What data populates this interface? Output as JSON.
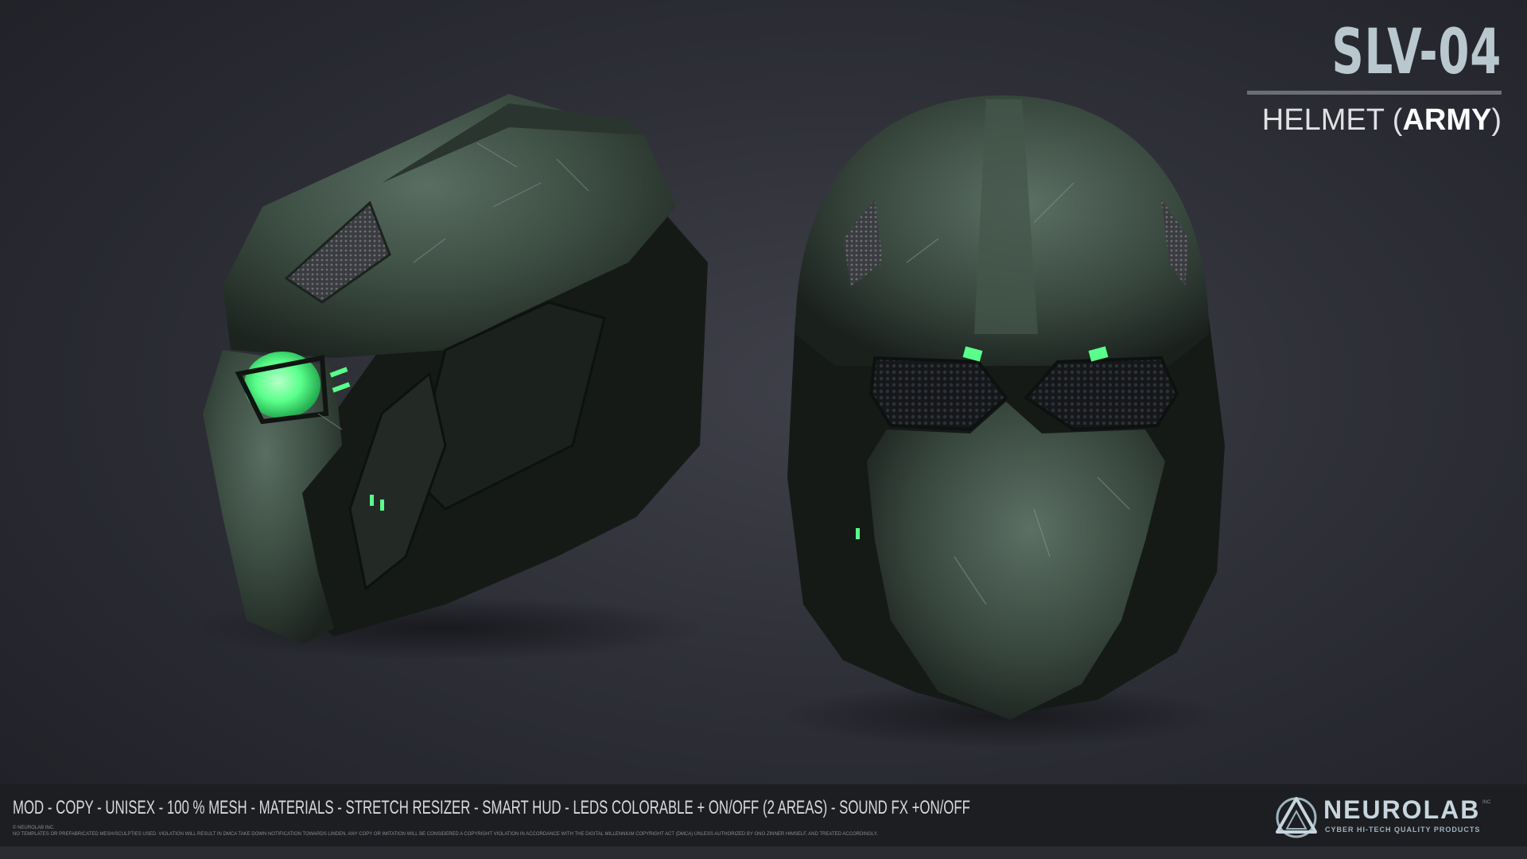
{
  "header": {
    "product_code": "SLV-04",
    "subtitle_prefix": "HELMET (",
    "subtitle_emphasis": "ARMY",
    "subtitle_suffix": ")"
  },
  "footer": {
    "features": "MOD - COPY - UNISEX - 100 % MESH - MATERIALS - STRETCH RESIZER - SMART HUD - LEDS COLORABLE + ON/OFF (2 AREAS) - SOUND FX +ON/OFF",
    "copyright": "© NEUROLAB INC.",
    "legal": "NO TEMPLATES OR PREFABRICATED MESH/SCULPTIES USED. VIOLATION WILL RESULT IN DMCA TAKE DOWN NOTIFICATION TOWARDS LINDEN. ANY COPY OR IMITATION WILL BE CONSIDERED A COPYRIGHT VIOLATION IN ACCORDANCE WITH THE DIGITAL MILLENNIUM COPYRIGHT ACT (DMCA) UNLESS AUTHORIZED BY ONO ZINNER HIMSELF, AND TREATED ACCORDINGLY."
  },
  "brand": {
    "name": "NEUROLAB",
    "suffix": "INC",
    "tagline": "CYBER HI-TECH QUALITY PRODUCTS",
    "logo_icon": "triangle-circle-logo-icon"
  },
  "colors": {
    "helmet_green": "#3d4f44",
    "led_green": "#59ff8a",
    "background": "#34353d",
    "title_blue": "#b9c7cf"
  }
}
